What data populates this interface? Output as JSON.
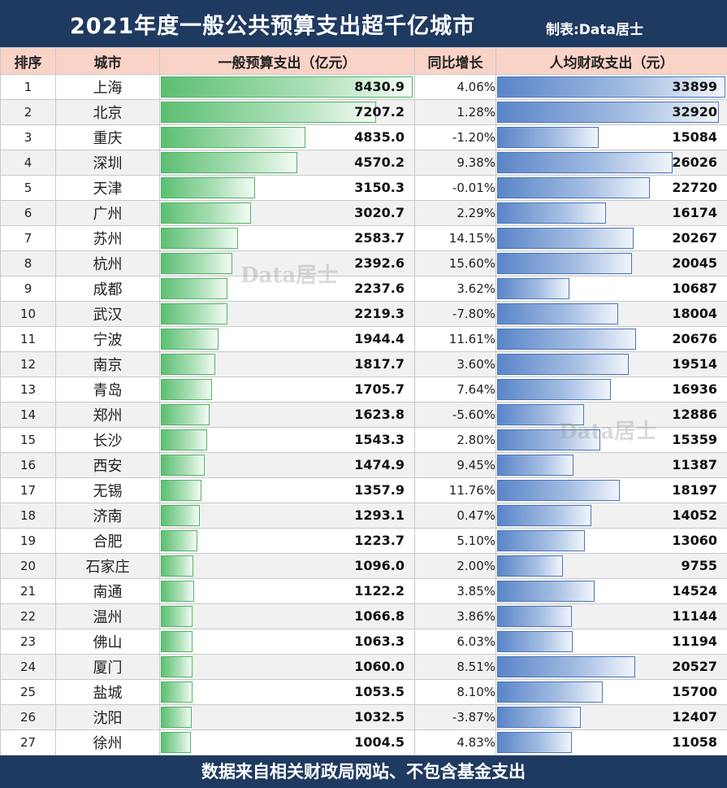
{
  "title": "2021年度一般公共预算支出超千亿城市",
  "credit": "制表:Data居士",
  "footer": "数据来自相关财政局网站、不包含基金支出",
  "watermark": "Data居士",
  "colors": {
    "header_bg": "#1f3a61",
    "header_row": "#f9d3c6",
    "green_bar": "#5cbf72",
    "blue_bar": "#5a85c8"
  },
  "chart_data": {
    "type": "table",
    "columns": [
      "排序",
      "城市",
      "一般预算支出（亿元）",
      "同比增长",
      "人均财政支出（元）"
    ],
    "rows": [
      {
        "rank": "1",
        "city": "上海",
        "spending": 8430.9,
        "yoy": "4.06%",
        "per_capita": 33899
      },
      {
        "rank": "2",
        "city": "北京",
        "spending": 7207.2,
        "yoy": "1.28%",
        "per_capita": 32920
      },
      {
        "rank": "3",
        "city": "重庆",
        "spending": 4835.0,
        "yoy": "-1.20%",
        "per_capita": 15084
      },
      {
        "rank": "4",
        "city": "深圳",
        "spending": 4570.2,
        "yoy": "9.38%",
        "per_capita": 26026
      },
      {
        "rank": "5",
        "city": "天津",
        "spending": 3150.3,
        "yoy": "-0.01%",
        "per_capita": 22720
      },
      {
        "rank": "6",
        "city": "广州",
        "spending": 3020.7,
        "yoy": "2.29%",
        "per_capita": 16174
      },
      {
        "rank": "7",
        "city": "苏州",
        "spending": 2583.7,
        "yoy": "14.15%",
        "per_capita": 20267
      },
      {
        "rank": "8",
        "city": "杭州",
        "spending": 2392.6,
        "yoy": "15.60%",
        "per_capita": 20045
      },
      {
        "rank": "9",
        "city": "成都",
        "spending": 2237.6,
        "yoy": "3.62%",
        "per_capita": 10687
      },
      {
        "rank": "10",
        "city": "武汉",
        "spending": 2219.3,
        "yoy": "-7.80%",
        "per_capita": 18004
      },
      {
        "rank": "11",
        "city": "宁波",
        "spending": 1944.4,
        "yoy": "11.61%",
        "per_capita": 20676
      },
      {
        "rank": "12",
        "city": "南京",
        "spending": 1817.7,
        "yoy": "3.60%",
        "per_capita": 19514
      },
      {
        "rank": "13",
        "city": "青岛",
        "spending": 1705.7,
        "yoy": "7.64%",
        "per_capita": 16936
      },
      {
        "rank": "14",
        "city": "郑州",
        "spending": 1623.8,
        "yoy": "-5.60%",
        "per_capita": 12886
      },
      {
        "rank": "15",
        "city": "长沙",
        "spending": 1543.3,
        "yoy": "2.80%",
        "per_capita": 15359
      },
      {
        "rank": "16",
        "city": "西安",
        "spending": 1474.9,
        "yoy": "9.45%",
        "per_capita": 11387
      },
      {
        "rank": "17",
        "city": "无锡",
        "spending": 1357.9,
        "yoy": "11.76%",
        "per_capita": 18197
      },
      {
        "rank": "18",
        "city": "济南",
        "spending": 1293.1,
        "yoy": "0.47%",
        "per_capita": 14052
      },
      {
        "rank": "19",
        "city": "合肥",
        "spending": 1223.7,
        "yoy": "5.10%",
        "per_capita": 13060
      },
      {
        "rank": "20",
        "city": "石家庄",
        "spending": 1096.0,
        "yoy": "2.00%",
        "per_capita": 9755
      },
      {
        "rank": "21",
        "city": "南通",
        "spending": 1122.2,
        "yoy": "3.85%",
        "per_capita": 14524
      },
      {
        "rank": "22",
        "city": "温州",
        "spending": 1066.8,
        "yoy": "3.86%",
        "per_capita": 11144
      },
      {
        "rank": "23",
        "city": "佛山",
        "spending": 1063.3,
        "yoy": "6.03%",
        "per_capita": 11194
      },
      {
        "rank": "24",
        "city": "厦门",
        "spending": 1060.0,
        "yoy": "8.51%",
        "per_capita": 20527
      },
      {
        "rank": "25",
        "city": "盐城",
        "spending": 1053.5,
        "yoy": "8.10%",
        "per_capita": 15700
      },
      {
        "rank": "26",
        "city": "沈阳",
        "spending": 1032.5,
        "yoy": "-3.87%",
        "per_capita": 12407
      },
      {
        "rank": "27",
        "city": "徐州",
        "spending": 1004.5,
        "yoy": "4.83%",
        "per_capita": 11058
      }
    ]
  }
}
